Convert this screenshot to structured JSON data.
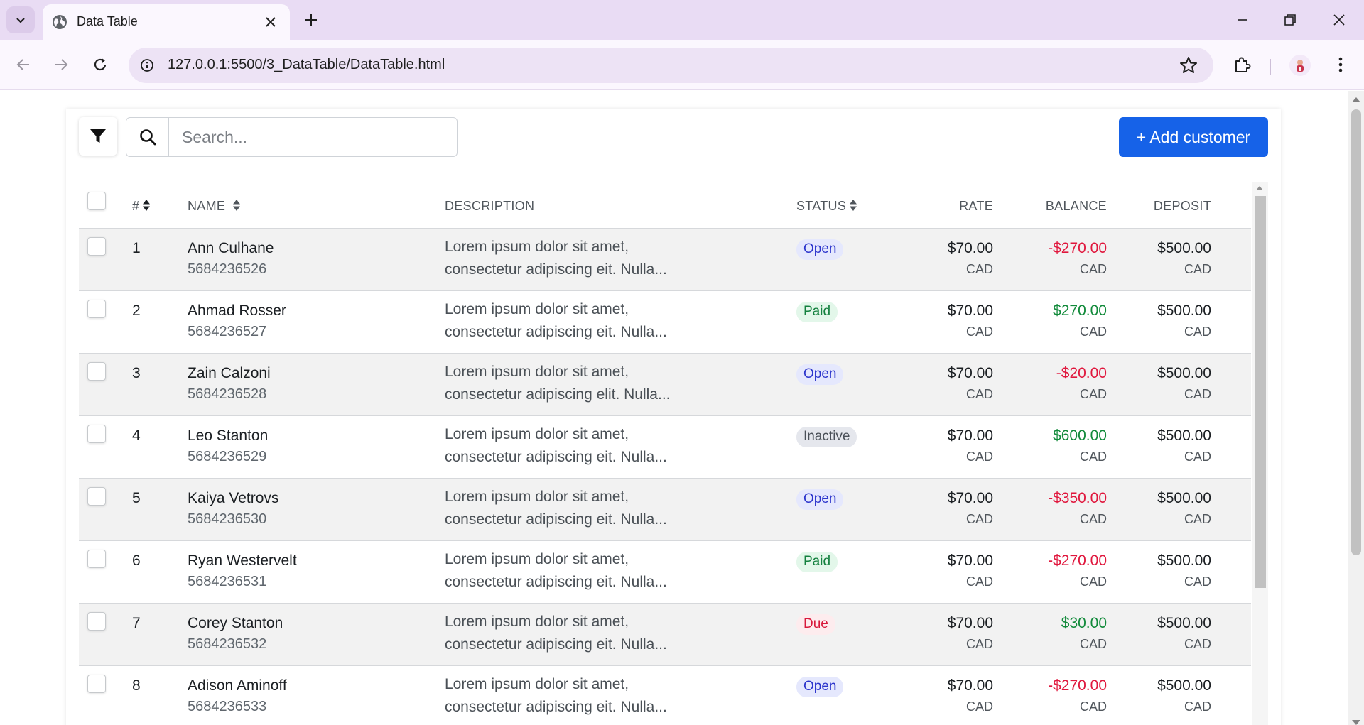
{
  "browser": {
    "tab_title": "Data Table",
    "url": "127.0.0.1:5500/3_DataTable/DataTable.html"
  },
  "colors": {
    "accent": "#1662e8",
    "negative": "#e0173d",
    "positive": "#118a3a"
  },
  "toolbar": {
    "search_placeholder": "Search...",
    "add_label": "+ Add customer"
  },
  "columns": {
    "id": "#",
    "name": "NAME",
    "description": "DESCRIPTION",
    "status": "STATUS",
    "rate": "RATE",
    "balance": "BALANCE",
    "deposit": "DEPOSIT"
  },
  "status_styles": {
    "Open": {
      "bg": "#e5e8fd",
      "fg": "#2c35cc"
    },
    "Paid": {
      "bg": "#e3f7ea",
      "fg": "#14813f"
    },
    "Inactive": {
      "bg": "#e5e7ed",
      "fg": "#4a5058"
    },
    "Due": {
      "bg": "#fdecee",
      "fg": "#d81a3c"
    }
  },
  "rows": [
    {
      "id": "1",
      "name": "Ann Culhane",
      "phone": "5684236526",
      "desc1": "Lorem ipsum dolor sit amet,",
      "desc2": "consectetur adipiscing eit. Nulla...",
      "status": "Open",
      "rate": "$70.00",
      "rate_cur": "CAD",
      "balance": "-$270.00",
      "balance_cur": "CAD",
      "balance_sign": "neg",
      "deposit": "$500.00",
      "deposit_cur": "CAD"
    },
    {
      "id": "2",
      "name": "Ahmad Rosser",
      "phone": "5684236527",
      "desc1": "Lorem ipsum dolor sit amet,",
      "desc2": "consectetur adipiscing eit. Nulla...",
      "status": "Paid",
      "rate": "$70.00",
      "rate_cur": "CAD",
      "balance": "$270.00",
      "balance_cur": "CAD",
      "balance_sign": "pos",
      "deposit": "$500.00",
      "deposit_cur": "CAD"
    },
    {
      "id": "3",
      "name": "Zain Calzoni",
      "phone": "5684236528",
      "desc1": "Lorem ipsum dolor sit amet,",
      "desc2": "consectetur adipiscing elit. Nulla...",
      "status": "Open",
      "rate": "$70.00",
      "rate_cur": "CAD",
      "balance": "-$20.00",
      "balance_cur": "CAD",
      "balance_sign": "neg",
      "deposit": "$500.00",
      "deposit_cur": "CAD"
    },
    {
      "id": "4",
      "name": "Leo Stanton",
      "phone": "5684236529",
      "desc1": "Lorem ipsum dolor sit amet,",
      "desc2": "consectetur adipiscing eit. Nulla...",
      "status": "Inactive",
      "rate": "$70.00",
      "rate_cur": "CAD",
      "balance": "$600.00",
      "balance_cur": "CAD",
      "balance_sign": "pos",
      "deposit": "$500.00",
      "deposit_cur": "CAD"
    },
    {
      "id": "5",
      "name": "Kaiya Vetrovs",
      "phone": "5684236530",
      "desc1": "Lorem ipsum dolor sit amet,",
      "desc2": "consectetur adipiscing eit. Nulla...",
      "status": "Open",
      "rate": "$70.00",
      "rate_cur": "CAD",
      "balance": "-$350.00",
      "balance_cur": "CAD",
      "balance_sign": "neg",
      "deposit": "$500.00",
      "deposit_cur": "CAD"
    },
    {
      "id": "6",
      "name": "Ryan Westervelt",
      "phone": "5684236531",
      "desc1": "Lorem ipsum dolor sit amet,",
      "desc2": "consectetur adipiscing eit. Nulla...",
      "status": "Paid",
      "rate": "$70.00",
      "rate_cur": "CAD",
      "balance": "-$270.00",
      "balance_cur": "CAD",
      "balance_sign": "neg",
      "deposit": "$500.00",
      "deposit_cur": "CAD"
    },
    {
      "id": "7",
      "name": "Corey Stanton",
      "phone": "5684236532",
      "desc1": "Lorem ipsum dolor sit amet,",
      "desc2": "consectetur adipiscing eit. Nulla...",
      "status": "Due",
      "rate": "$70.00",
      "rate_cur": "CAD",
      "balance": "$30.00",
      "balance_cur": "CAD",
      "balance_sign": "pos",
      "deposit": "$500.00",
      "deposit_cur": "CAD"
    },
    {
      "id": "8",
      "name": "Adison Aminoff",
      "phone": "5684236533",
      "desc1": "Lorem ipsum dolor sit amet,",
      "desc2": "consectetur adipiscing eit. Nulla...",
      "status": "Open",
      "rate": "$70.00",
      "rate_cur": "CAD",
      "balance": "-$270.00",
      "balance_cur": "CAD",
      "balance_sign": "neg",
      "deposit": "$500.00",
      "deposit_cur": "CAD"
    }
  ]
}
